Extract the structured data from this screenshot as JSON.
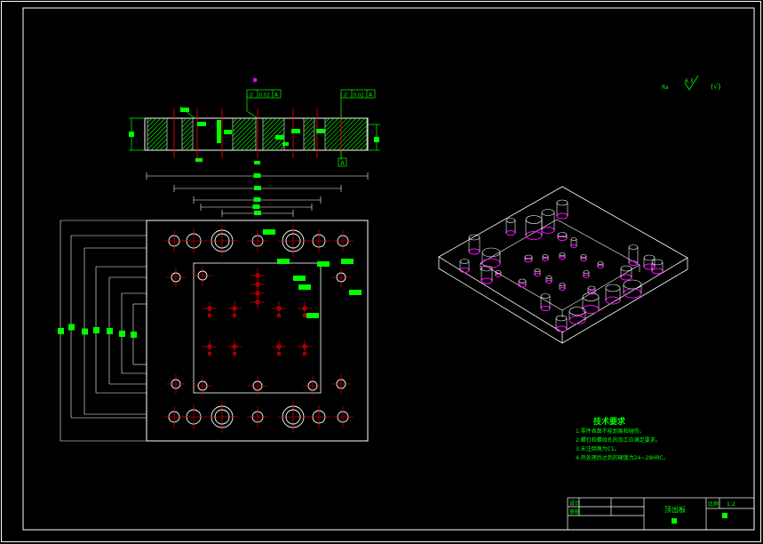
{
  "colors": {
    "background": "#000000",
    "outline": "#ffffff",
    "dimension": "#00ff00",
    "centerline": "#ff0000",
    "hole": "#ff00ff",
    "hatch": "#00ff00"
  },
  "roughness": {
    "label": "Ra",
    "value": "6.3",
    "paren": "(√)"
  },
  "tolerance_frames": [
    {
      "symbol": "//",
      "value": "0.02",
      "datum": "A"
    },
    {
      "symbol": "//",
      "value": "0.02",
      "datum": "A"
    }
  ],
  "datum_label": "A",
  "tech_requirements": {
    "title": "技术要求",
    "items": [
      "1.零件表面不能划痕和碰伤。",
      "2.螺钉和螺纹孔的加工应满足要求。",
      "3.未注倒角为C1。",
      "4.热处理后达到的硬度为24~28HRC。"
    ]
  },
  "title_block": {
    "part_name": "顶出板",
    "scale_label": "比例",
    "scale": "1:2",
    "row_labels": [
      "设计",
      "审核"
    ]
  }
}
